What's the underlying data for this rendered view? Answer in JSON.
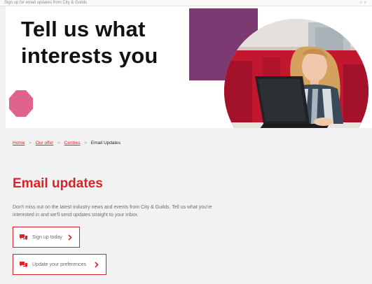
{
  "browser": {
    "tab_text": "Sign up for email updates from City & Guilds",
    "icons": "☆ ⌕"
  },
  "hero": {
    "title_line1": "Tell us what",
    "title_line2": "interests you",
    "photo_icon": "woman-with-laptop-photo"
  },
  "breadcrumb": {
    "items": [
      {
        "label": "Home",
        "link": true
      },
      {
        "label": "Our offer",
        "link": true
      },
      {
        "label": "Centres",
        "link": true
      },
      {
        "label": "Email Updates",
        "link": false
      }
    ],
    "separator": ">"
  },
  "main": {
    "title": "Email updates",
    "intro": "Don't miss out on the latest industry news and events from City & Guilds. Tell us what you're interested in and we'll send updates straight to your inbox.",
    "buttons": [
      {
        "label": "Sign up today",
        "icon": "chat-icon"
      },
      {
        "label": "Update your preferences",
        "icon": "chat-icon"
      }
    ]
  },
  "colors": {
    "accent": "#d8232a",
    "purple": "#7b3a72",
    "pink": "#e0628e"
  }
}
